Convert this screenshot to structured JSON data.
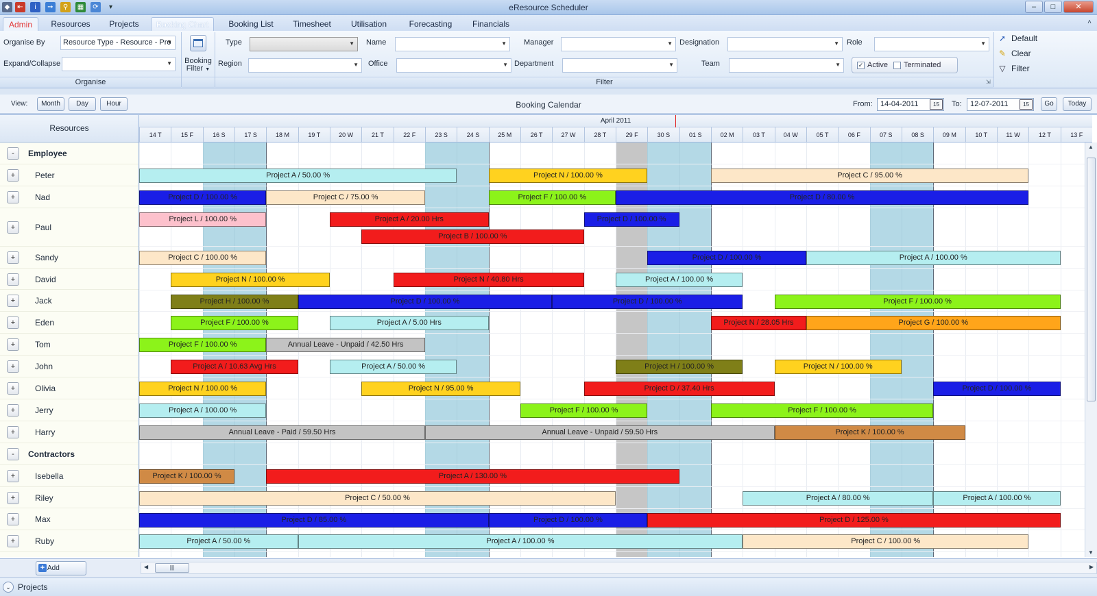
{
  "app": {
    "title": "eResource Scheduler"
  },
  "ribbon_tabs": [
    "Admin",
    "Resources",
    "Projects",
    "Booking Chart",
    "Booking List",
    "Timesheet",
    "Utilisation",
    "Forecasting",
    "Financials"
  ],
  "organise": {
    "organise_by_label": "Organise By",
    "organise_by_value": "Resource Type - Resource - Pro",
    "expand_label": "Expand/Collapse",
    "group_caption": "Organise"
  },
  "booking_filter": {
    "label_line1": "Booking",
    "label_line2": "Filter"
  },
  "filter": {
    "type_label": "Type",
    "region_label": "Region",
    "name_label": "Name",
    "office_label": "Office",
    "manager_label": "Manager",
    "department_label": "Department",
    "designation_label": "Designation",
    "team_label": "Team",
    "role_label": "Role",
    "active_label": "Active",
    "active_checked": true,
    "terminated_label": "Terminated",
    "terminated_checked": false,
    "group_caption": "Filter"
  },
  "side_actions": {
    "default_label": "Default",
    "clear_label": "Clear",
    "filter_label": "Filter"
  },
  "viewbar": {
    "view_label": "View:",
    "month": "Month",
    "day": "Day",
    "hour": "Hour",
    "title": "Booking Calendar",
    "from_label": "From:",
    "from_value": "14-04-2011",
    "to_label": "To:",
    "to_value": "12-07-2011",
    "calendar_glyph": "15",
    "go": "Go",
    "today": "Today"
  },
  "grid": {
    "resources_header": "Resources",
    "month_label": "April 2011",
    "days": [
      "14 T",
      "15 F",
      "16 S",
      "17 S",
      "18 M",
      "19 T",
      "20 W",
      "21 T",
      "22 F",
      "23 S",
      "24 S",
      "25 M",
      "26 T",
      "27 W",
      "28 T",
      "29 F",
      "30 S",
      "01 S",
      "02 M",
      "03 T",
      "04 W",
      "05 T",
      "06 F",
      "07 S",
      "08 S",
      "09 M",
      "10 T",
      "11 W",
      "12 T",
      "13 F"
    ],
    "weekend_day_indexes": [
      2,
      3,
      9,
      10,
      16,
      17,
      23,
      24
    ],
    "holiday_day_indexes": [
      15
    ],
    "week_start_indexes": [
      4,
      11,
      18,
      25
    ]
  },
  "resources": [
    {
      "kind": "group",
      "name": "Employee",
      "toggle": "-"
    },
    {
      "kind": "res",
      "name": "Peter",
      "toggle": "+",
      "tall": false,
      "bookings": [
        {
          "label": "Project A / 50.00 %",
          "start": 0,
          "end": 10,
          "color": "#b5eef0"
        },
        {
          "label": "Project N / 100.00 %",
          "start": 11,
          "end": 16,
          "color": "#ffd21f"
        },
        {
          "label": "Project C / 95.00 %",
          "start": 18,
          "end": 28,
          "color": "#fde7c8"
        }
      ]
    },
    {
      "kind": "res",
      "name": "Nad",
      "toggle": "+",
      "tall": false,
      "bookings": [
        {
          "label": "Project D / 100.00 %",
          "start": 0,
          "end": 4,
          "color": "#1a1ee6"
        },
        {
          "label": "Project C / 75.00 %",
          "start": 4,
          "end": 9,
          "color": "#fde7c8"
        },
        {
          "label": "Project F / 100.00 %",
          "start": 11,
          "end": 15,
          "color": "#8cf31a"
        },
        {
          "label": "Project D / 80.00 %",
          "start": 15,
          "end": 28,
          "color": "#1a1ee6"
        }
      ]
    },
    {
      "kind": "res",
      "name": "Paul",
      "toggle": "+",
      "tall": true,
      "bookings": [
        {
          "label": "Project L / 100.00 %",
          "start": 0,
          "end": 4,
          "color": "#fdc1cc",
          "lane": 0
        },
        {
          "label": "Project A / 20.00 Hrs",
          "start": 6,
          "end": 11,
          "color": "#f21c1c",
          "lane": 0
        },
        {
          "label": "Project D / 100.00 %",
          "start": 14,
          "end": 17,
          "color": "#1a1ee6",
          "lane": 0
        },
        {
          "label": "Project B / 100.00 %",
          "start": 7,
          "end": 14,
          "color": "#f21c1c",
          "lane": 1
        }
      ]
    },
    {
      "kind": "res",
      "name": "Sandy",
      "toggle": "+",
      "tall": false,
      "bookings": [
        {
          "label": "Project C / 100.00 %",
          "start": 0,
          "end": 4,
          "color": "#fde7c8"
        },
        {
          "label": "Project D / 100.00 %",
          "start": 16,
          "end": 21,
          "color": "#1a1ee6"
        },
        {
          "label": "Project A / 100.00 %",
          "start": 21,
          "end": 29,
          "color": "#b5eef0"
        }
      ]
    },
    {
      "kind": "res",
      "name": "David",
      "toggle": "+",
      "tall": false,
      "bookings": [
        {
          "label": "Project N / 100.00 %",
          "start": 1,
          "end": 6,
          "color": "#ffd21f"
        },
        {
          "label": "Project N / 40.80 Hrs",
          "start": 8,
          "end": 14,
          "color": "#f21c1c"
        },
        {
          "label": "Project A / 100.00 %",
          "start": 15,
          "end": 19,
          "color": "#b5eef0"
        }
      ]
    },
    {
      "kind": "res",
      "name": "Jack",
      "toggle": "+",
      "tall": false,
      "bookings": [
        {
          "label": "Project H / 100.00 %",
          "start": 1,
          "end": 5,
          "color": "#7f7f18"
        },
        {
          "label": "Project D / 100.00 %",
          "start": 5,
          "end": 13,
          "color": "#1a1ee6"
        },
        {
          "label": "Project D / 100.00 %",
          "start": 13,
          "end": 19,
          "color": "#1a1ee6"
        },
        {
          "label": "Project F / 100.00 %",
          "start": 20,
          "end": 29,
          "color": "#8cf31a"
        }
      ]
    },
    {
      "kind": "res",
      "name": "Eden",
      "toggle": "+",
      "tall": false,
      "bookings": [
        {
          "label": "Project F / 100.00 %",
          "start": 1,
          "end": 5,
          "color": "#8cf31a"
        },
        {
          "label": "Project A / 5.00 Hrs",
          "start": 6,
          "end": 11,
          "color": "#b5eef0"
        },
        {
          "label": "Project N / 28.05 Hrs",
          "start": 18,
          "end": 21,
          "color": "#f21c1c"
        },
        {
          "label": "Project G / 100.00 %",
          "start": 21,
          "end": 29,
          "color": "#ffa51a"
        }
      ]
    },
    {
      "kind": "res",
      "name": "Tom",
      "toggle": "+",
      "tall": false,
      "bookings": [
        {
          "label": "Project F / 100.00 %",
          "start": 0,
          "end": 4,
          "color": "#8cf31a"
        },
        {
          "label": "Annual Leave - Unpaid / 42.50 Hrs",
          "start": 4,
          "end": 9,
          "color": "#c3c3c3"
        }
      ]
    },
    {
      "kind": "res",
      "name": "John",
      "toggle": "+",
      "tall": false,
      "bookings": [
        {
          "label": "Project A / 10.63 Avg Hrs",
          "start": 1,
          "end": 5,
          "color": "#f21c1c"
        },
        {
          "label": "Project A / 50.00 %",
          "start": 6,
          "end": 10,
          "color": "#b5eef0"
        },
        {
          "label": "Project H / 100.00 %",
          "start": 15,
          "end": 19,
          "color": "#7f7f18"
        },
        {
          "label": "Project N / 100.00 %",
          "start": 20,
          "end": 24,
          "color": "#ffd21f"
        }
      ]
    },
    {
      "kind": "res",
      "name": "Olivia",
      "toggle": "+",
      "tall": false,
      "bookings": [
        {
          "label": "Project N / 100.00 %",
          "start": 0,
          "end": 4,
          "color": "#ffd21f"
        },
        {
          "label": "Project N / 95.00 %",
          "start": 7,
          "end": 12,
          "color": "#ffd21f"
        },
        {
          "label": "Project D / 37.40 Hrs",
          "start": 14,
          "end": 20,
          "color": "#f21c1c"
        },
        {
          "label": "Project D / 100.00 %",
          "start": 25,
          "end": 29,
          "color": "#1a1ee6"
        }
      ]
    },
    {
      "kind": "res",
      "name": "Jerry",
      "toggle": "+",
      "tall": false,
      "bookings": [
        {
          "label": "Project A / 100.00 %",
          "start": 0,
          "end": 4,
          "color": "#b5eef0"
        },
        {
          "label": "Project F / 100.00 %",
          "start": 12,
          "end": 16,
          "color": "#8cf31a"
        },
        {
          "label": "Project F / 100.00 %",
          "start": 18,
          "end": 25,
          "color": "#8cf31a"
        }
      ]
    },
    {
      "kind": "res",
      "name": "Harry",
      "toggle": "+",
      "tall": false,
      "bookings": [
        {
          "label": "Annual Leave - Paid / 59.50 Hrs",
          "start": 0,
          "end": 9,
          "color": "#c3c3c3"
        },
        {
          "label": "Annual Leave - Unpaid / 59.50 Hrs",
          "start": 9,
          "end": 20,
          "color": "#c3c3c3"
        },
        {
          "label": "Project K / 100.00 %",
          "start": 20,
          "end": 26,
          "color": "#d08a45"
        }
      ]
    },
    {
      "kind": "group",
      "name": "Contractors",
      "toggle": "-"
    },
    {
      "kind": "res",
      "name": "Isebella",
      "toggle": "+",
      "tall": false,
      "bookings": [
        {
          "label": "Project K / 100.00 %",
          "start": 0,
          "end": 3,
          "color": "#d08a45"
        },
        {
          "label": "Project A / 130.00 %",
          "start": 4,
          "end": 17,
          "color": "#f21c1c"
        }
      ]
    },
    {
      "kind": "res",
      "name": "Riley",
      "toggle": "+",
      "tall": false,
      "bookings": [
        {
          "label": "Project C / 50.00 %",
          "start": 0,
          "end": 15,
          "color": "#fde7c8"
        },
        {
          "label": "Project A / 80.00 %",
          "start": 19,
          "end": 25,
          "color": "#b5eef0"
        },
        {
          "label": "Project A / 100.00 %",
          "start": 25,
          "end": 29,
          "color": "#b5eef0"
        }
      ]
    },
    {
      "kind": "res",
      "name": "Max",
      "toggle": "+",
      "tall": false,
      "bookings": [
        {
          "label": "Project D / 85.00 %",
          "start": 0,
          "end": 11,
          "color": "#1a1ee6"
        },
        {
          "label": "Project D / 100.00 %",
          "start": 11,
          "end": 16,
          "color": "#1a1ee6"
        },
        {
          "label": "Project D / 125.00 %",
          "start": 16,
          "end": 29,
          "color": "#f21c1c"
        }
      ]
    },
    {
      "kind": "res",
      "name": "Ruby",
      "toggle": "+",
      "tall": false,
      "bookings": [
        {
          "label": "Project A / 50.00 %",
          "start": 0,
          "end": 5,
          "color": "#b5eef0"
        },
        {
          "label": "Project A / 100.00 %",
          "start": 5,
          "end": 19,
          "color": "#b5eef0"
        },
        {
          "label": "Project C / 100.00 %",
          "start": 19,
          "end": 28,
          "color": "#fde7c8"
        }
      ]
    }
  ],
  "footer": {
    "add_bookings": "Add Bookings",
    "scroll_grip": "|||"
  },
  "projects_panel": {
    "label": "Projects"
  }
}
